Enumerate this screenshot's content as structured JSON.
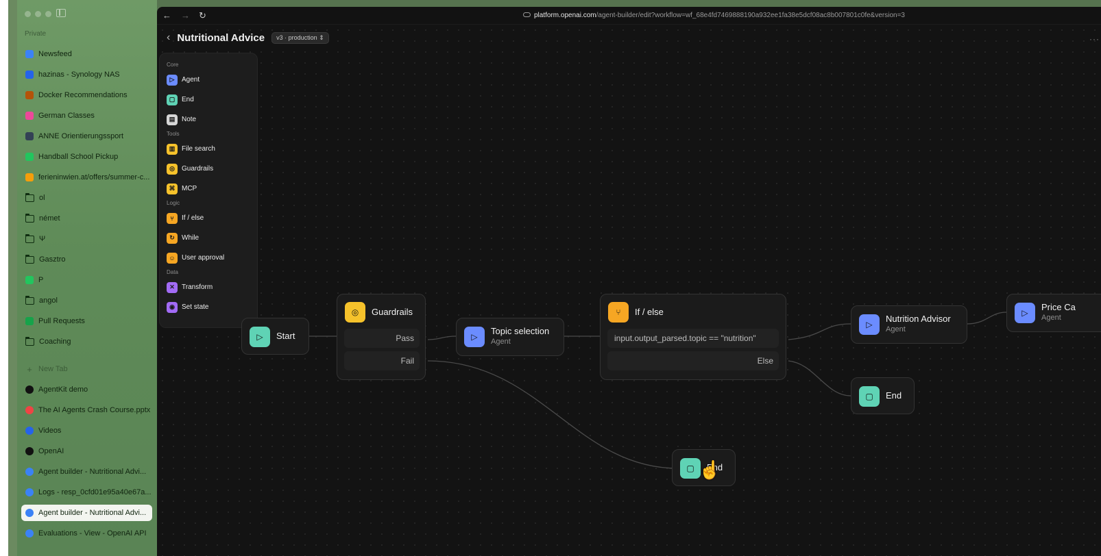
{
  "sidebar": {
    "section": "Private",
    "tabs": [
      {
        "label": "Newsfeed",
        "icon": "newsfeed-icon",
        "color": "#3b82f6"
      },
      {
        "label": "hazinas - Synology NAS",
        "icon": "synology-icon",
        "color": "#2563eb"
      },
      {
        "label": "Docker Recommendations",
        "icon": "docker-icon",
        "color": "#b45309"
      },
      {
        "label": "German Classes",
        "icon": "german-classes-icon",
        "color": "#ec4899"
      },
      {
        "label": "ANNE Orientierungssport",
        "icon": "anne-icon",
        "color": "#334155"
      },
      {
        "label": "Handball School Pickup",
        "icon": "plus-cross-icon",
        "color": "#22c55e"
      },
      {
        "label": "ferieninwien.at/offers/summer-c...",
        "icon": "ferien-icon",
        "color": "#f59e0b"
      },
      {
        "label": "ol",
        "icon": "folder-icon"
      },
      {
        "label": "német",
        "icon": "folder-icon"
      },
      {
        "label": "Ψ",
        "icon": "folder-icon"
      },
      {
        "label": "Gasztro",
        "icon": "folder-icon"
      },
      {
        "label": "P",
        "icon": "plus-cross-icon",
        "color": "#22c55e"
      },
      {
        "label": "angol",
        "icon": "folder-icon"
      },
      {
        "label": "Pull Requests",
        "icon": "pull-requests-icon",
        "color": "#16a34a"
      },
      {
        "label": "Coaching",
        "icon": "folder-icon"
      }
    ],
    "new_tab": "New Tab",
    "open_tabs": [
      {
        "label": "AgentKit demo",
        "icon": "agentkit-icon",
        "color": "#111111"
      },
      {
        "label": "The AI Agents Crash Course.pptx",
        "icon": "pptx-icon",
        "color": "#ef4444"
      },
      {
        "label": "Videos",
        "icon": "videos-icon",
        "color": "#2563eb"
      },
      {
        "label": "OpenAI",
        "icon": "openai-icon",
        "color": "#111111"
      },
      {
        "label": "Agent builder - Nutritional Advi...",
        "icon": "openai-platform-icon",
        "color": "#3b82f6"
      },
      {
        "label": "Logs - resp_0cfd01e95a40e67a...",
        "icon": "openai-platform-icon",
        "color": "#3b82f6"
      },
      {
        "label": "Agent builder - Nutritional Advi...",
        "icon": "openai-platform-icon",
        "color": "#3b82f6",
        "active": true
      },
      {
        "label": "Evaluations - View - OpenAI API",
        "icon": "openai-platform-icon",
        "color": "#3b82f6"
      }
    ]
  },
  "browser": {
    "back": "←",
    "forward": "→",
    "reload": "↻",
    "url_host": "platform.openai.com",
    "url_path": "/agent-builder/edit?workflow=wf_68e4fd7469888190a932ee1fa38e5dcf08ac8b007801c0fe&version=3"
  },
  "workflow": {
    "back": "‹",
    "title": "Nutritional Advice",
    "version": "v3 · production",
    "more": "···"
  },
  "palette": {
    "groups": [
      {
        "label": "Core",
        "items": [
          {
            "label": "Agent",
            "icon": "agent-icon",
            "color": "#6b8cff",
            "glyph": "▷"
          },
          {
            "label": "End",
            "icon": "end-icon",
            "color": "#5fd3b5",
            "glyph": "▢"
          },
          {
            "label": "Note",
            "icon": "note-icon",
            "color": "#d6d6d6",
            "glyph": "▤"
          }
        ]
      },
      {
        "label": "Tools",
        "items": [
          {
            "label": "File search",
            "icon": "file-search-icon",
            "color": "#f6c22b",
            "glyph": "▥"
          },
          {
            "label": "Guardrails",
            "icon": "guardrails-icon",
            "color": "#f6c22b",
            "glyph": "◎"
          },
          {
            "label": "MCP",
            "icon": "mcp-icon",
            "color": "#f6c22b",
            "glyph": "⌘"
          }
        ]
      },
      {
        "label": "Logic",
        "items": [
          {
            "label": "If / else",
            "icon": "if-else-icon",
            "color": "#f6a623",
            "glyph": "⑂"
          },
          {
            "label": "While",
            "icon": "while-icon",
            "color": "#f6a623",
            "glyph": "↻"
          },
          {
            "label": "User approval",
            "icon": "user-approval-icon",
            "color": "#f6a623",
            "glyph": "☺"
          }
        ]
      },
      {
        "label": "Data",
        "items": [
          {
            "label": "Transform",
            "icon": "transform-icon",
            "color": "#a26bf5",
            "glyph": "✕"
          },
          {
            "label": "Set state",
            "icon": "set-state-icon",
            "color": "#a26bf5",
            "glyph": "◉"
          }
        ]
      }
    ]
  },
  "nodes": {
    "start": {
      "title": "Start",
      "icon": "play-icon",
      "glyph": "▷",
      "color": "#5fd3b5"
    },
    "guardrails": {
      "title": "Guardrails",
      "icon": "guardrails-icon",
      "glyph": "◎",
      "color": "#f6c22b",
      "pass": "Pass",
      "fail": "Fail"
    },
    "topic": {
      "title": "Topic selection",
      "sub": "Agent",
      "icon": "agent-icon",
      "glyph": "▷",
      "color": "#6b8cff"
    },
    "ifelse": {
      "title": "If / else",
      "icon": "if-else-icon",
      "glyph": "⑂",
      "color": "#f6a623",
      "condition": "input.output_parsed.topic == \"nutrition\"",
      "else": "Else"
    },
    "nutrition": {
      "title": "Nutrition Advisor",
      "sub": "Agent",
      "icon": "agent-icon",
      "glyph": "▷",
      "color": "#6b8cff"
    },
    "price": {
      "title": "Price Ca",
      "sub": "Agent",
      "icon": "agent-icon",
      "glyph": "▷",
      "color": "#6b8cff"
    },
    "end_else": {
      "title": "End",
      "icon": "end-icon",
      "glyph": "▢",
      "color": "#5fd3b5"
    },
    "end_fail": {
      "title": "End",
      "icon": "end-icon",
      "glyph": "▢",
      "color": "#5fd3b5"
    }
  },
  "cursor": {
    "icon": "hand-cursor-icon",
    "glyph": "☝"
  }
}
